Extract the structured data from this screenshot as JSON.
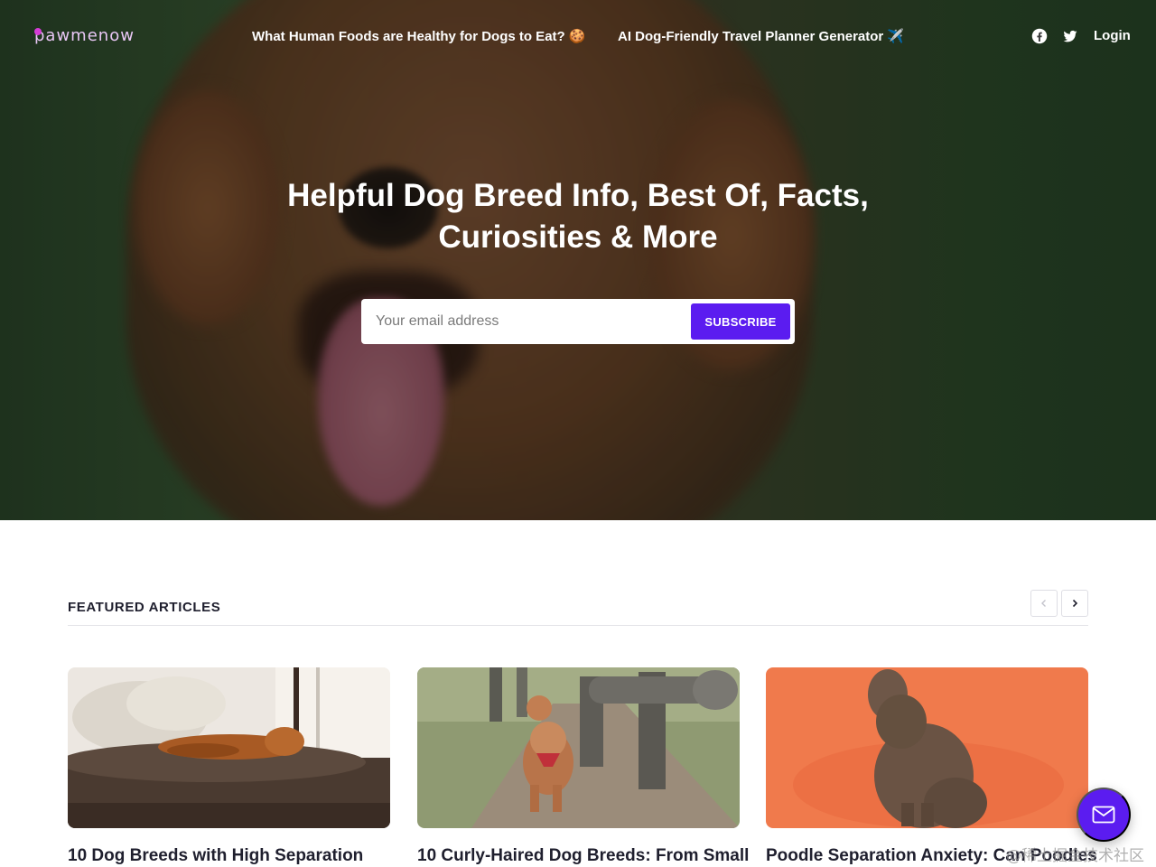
{
  "brand": {
    "logo_text": "pawmenow",
    "accent": "#5b1cf0",
    "logo_color": "#d53bd6"
  },
  "nav": {
    "links": [
      {
        "label": "What Human Foods are Healthy for Dogs to Eat? 🍪"
      },
      {
        "label": "AI Dog-Friendly Travel Planner Generator ✈️"
      }
    ],
    "social": [
      "facebook-icon",
      "twitter-icon"
    ],
    "login_label": "Login"
  },
  "hero": {
    "title_line1": "Helpful Dog Breed Info, Best Of, Facts,",
    "title_line2": "Curiosities & More",
    "email_placeholder": "Your email address",
    "subscribe_label": "SUBSCRIBE"
  },
  "featured": {
    "heading": "FEATURED ARTICLES",
    "articles": [
      {
        "title": "10 Dog Breeds with High Separation",
        "image": "golden-dog-on-bed"
      },
      {
        "title": "10 Curly-Haired Dog Breeds: From Small",
        "image": "poodle-on-path"
      },
      {
        "title": "Poodle Separation Anxiety: Can Poodles",
        "image": "poodle-orange-background"
      }
    ]
  },
  "fab": {
    "icon": "mail-icon"
  },
  "watermark": "@稀土掘金技术社区"
}
